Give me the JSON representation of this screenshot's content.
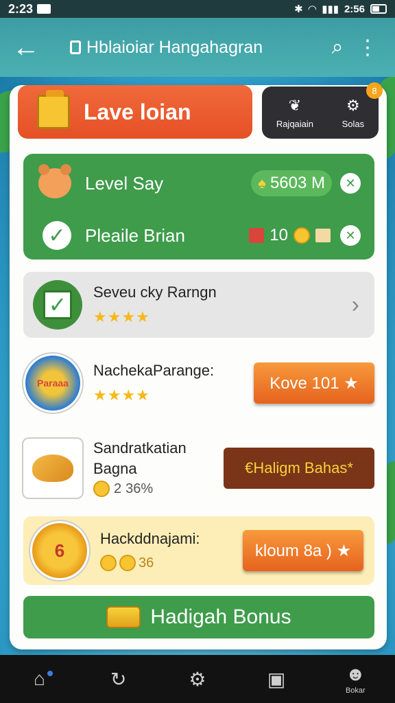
{
  "status_bar": {
    "time": "2:23",
    "signal_text": "2:56",
    "icons": [
      "bluetooth-icon",
      "wifi-icon",
      "signal-icon",
      "battery-icon"
    ]
  },
  "app_bar": {
    "title": "Hblaioiar Hangahagran",
    "icons": [
      "back-icon",
      "lock-icon",
      "search-icon",
      "more-icon"
    ]
  },
  "banner": {
    "label": "Lave loian"
  },
  "side_panel": {
    "items": [
      {
        "label": "Rajqaiain",
        "icon": "leaf-icon"
      },
      {
        "label": "Solas",
        "icon": "gear-icon"
      }
    ],
    "badge": "8"
  },
  "green_section": {
    "row1": {
      "label": "Level Say",
      "value": "5603 M"
    },
    "row2": {
      "label": "Pleaile Brian",
      "count": "10"
    }
  },
  "entries": {
    "item1": {
      "title": "Seveu cky Rarngn",
      "stars": "★★★★"
    },
    "item2": {
      "title": "NachekaParange:",
      "stars": "★★★★",
      "thumb": "Paraaa",
      "button": "Kove 101 ★"
    },
    "item3": {
      "title_line1": "Sandratkatian",
      "title_line2": "Bagna",
      "meta_prefix": "2",
      "meta_percent": "36%",
      "button": "€Haligm Bahas*"
    },
    "item4": {
      "title": "Hackddnajami:",
      "meta": "36",
      "thumb": "6",
      "button": "kloum 8a ) ★"
    }
  },
  "bonus_button": {
    "label": "Hadigah Bonus"
  },
  "bottom_nav": {
    "items": [
      {
        "icon": "home-icon",
        "label": ""
      },
      {
        "icon": "refresh-icon",
        "label": ""
      },
      {
        "icon": "settings-icon",
        "label": ""
      },
      {
        "icon": "window-icon",
        "label": ""
      },
      {
        "icon": "profile-icon",
        "label": "Bokar"
      }
    ]
  },
  "colors": {
    "primary": "#3e9c4b",
    "accent": "#e6621e",
    "teal": "#3d9ea2",
    "brown": "#7a3418"
  }
}
